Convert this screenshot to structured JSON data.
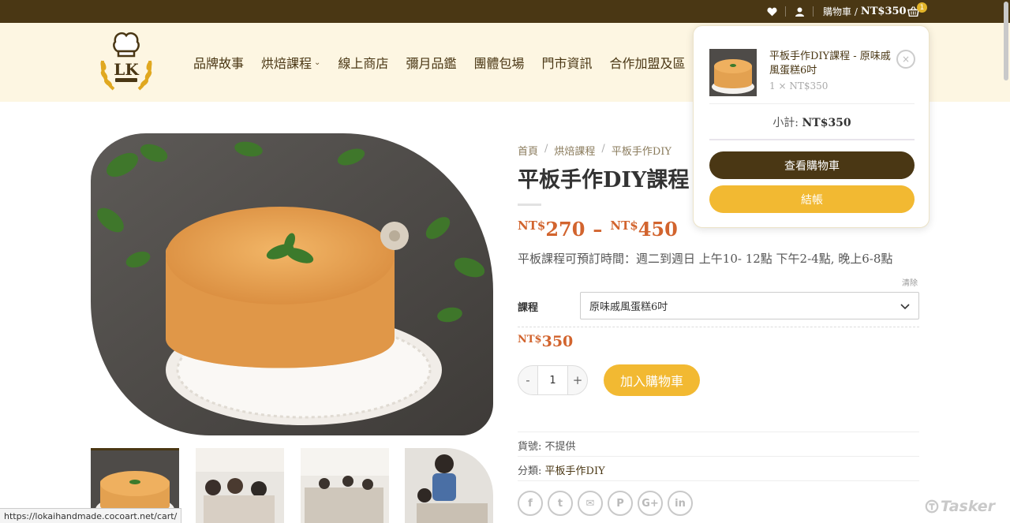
{
  "topbar": {
    "cart_label": "購物車 /",
    "cart_total": "NT$350",
    "cart_count": "1",
    "icons": [
      "heart-icon",
      "user-icon",
      "basket-icon"
    ]
  },
  "logo": {
    "letters": "LK"
  },
  "nav": {
    "items": [
      "品牌故事",
      "烘焙課程",
      "線上商店",
      "彌月品鑑",
      "團體包場",
      "門市資訊",
      "合作加盟及區"
    ]
  },
  "breadcrumb": {
    "home": "首頁",
    "cat": "烘焙課程",
    "sub": "平板手作DIY",
    "sep": "/"
  },
  "product": {
    "title": "平板手作DIY課程",
    "price_low_cur": "NT$",
    "price_low": "270",
    "price_dash": "–",
    "price_high_cur": "NT$",
    "price_high": "450",
    "description": "平板課程可預訂時間：週二到週日 上午10- 12點 下午2-4點, 晚上6-8點",
    "clear": "清除",
    "variation_label": "課程",
    "variation_value": "原味戚風蛋糕6吋",
    "price_cur": "NT$",
    "price": "350",
    "qty_minus": "-",
    "qty": "1",
    "qty_plus": "+",
    "add_to_cart": "加入購物車",
    "sku_label": "貨號:",
    "sku_value": "不提供",
    "cat_label": "分類:",
    "cat_value": "平板手作DIY"
  },
  "share": {
    "buttons": [
      {
        "icon": "facebook-icon",
        "glyph": "f"
      },
      {
        "icon": "twitter-icon",
        "glyph": "t"
      },
      {
        "icon": "email-icon",
        "glyph": "✉"
      },
      {
        "icon": "pinterest-icon",
        "glyph": "P"
      },
      {
        "icon": "google-plus-icon",
        "glyph": "G+"
      },
      {
        "icon": "linkedin-icon",
        "glyph": "in"
      }
    ]
  },
  "minicart": {
    "item_name": "平板手作DIY課程 - 原味戚風蛋糕6吋",
    "item_qty": "1 × NT$350",
    "remove": "×",
    "subtotal_label": "小計:",
    "subtotal_value": "NT$350",
    "view_cart": "查看購物車",
    "checkout": "結帳"
  },
  "status_url": "https://lokaihandmade.cocoart.net/cart/",
  "watermark": "Tasker",
  "colors": {
    "topbar": "#4a3714",
    "header": "#fdf6e2",
    "accent": "#f2b932",
    "price": "#d2642e"
  }
}
